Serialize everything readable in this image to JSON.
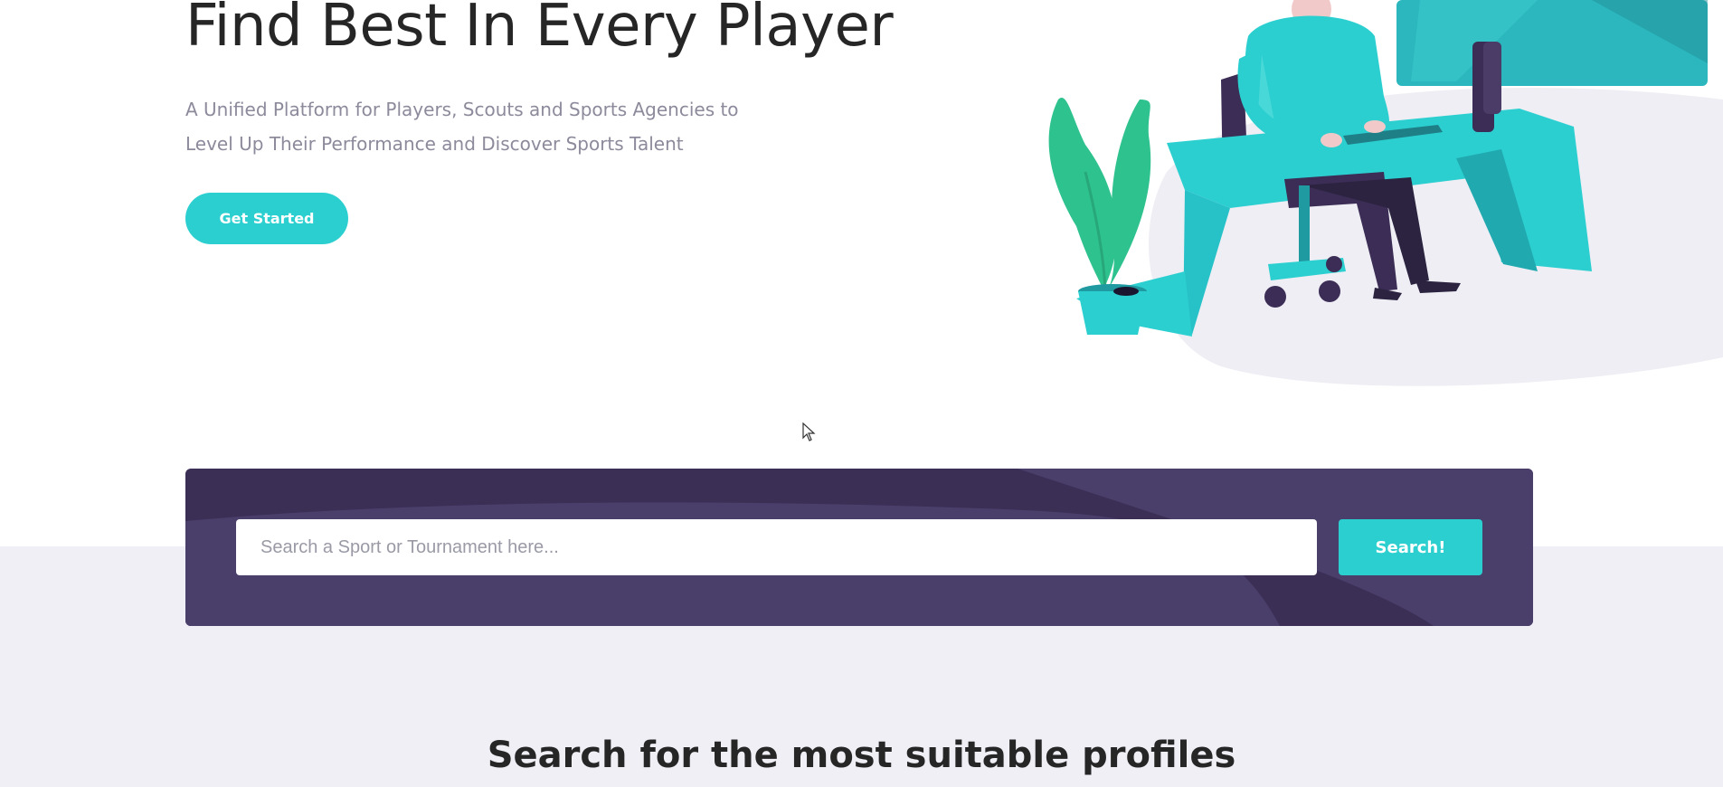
{
  "hero": {
    "title": "Find Best In Every Player",
    "subtitle_line1": "A Unified Platform for Players, Scouts and Sports Agencies to",
    "subtitle_line2": "Level Up Their Performance and Discover Sports Talent",
    "cta_label": "Get Started"
  },
  "illustration": {
    "icon": "person-at-desk-illustration"
  },
  "search": {
    "placeholder": "Search a Sport or Tournament here...",
    "value": "",
    "button_label": "Search!"
  },
  "section": {
    "title": "Search for the most suitable profiles"
  },
  "colors": {
    "accent": "#2ccfcf",
    "panel": "#3c2f55",
    "panel_light": "#4a3e6b",
    "text_dark": "#262626",
    "text_muted": "#8c8a9b",
    "lower_bg": "#efeff5"
  }
}
